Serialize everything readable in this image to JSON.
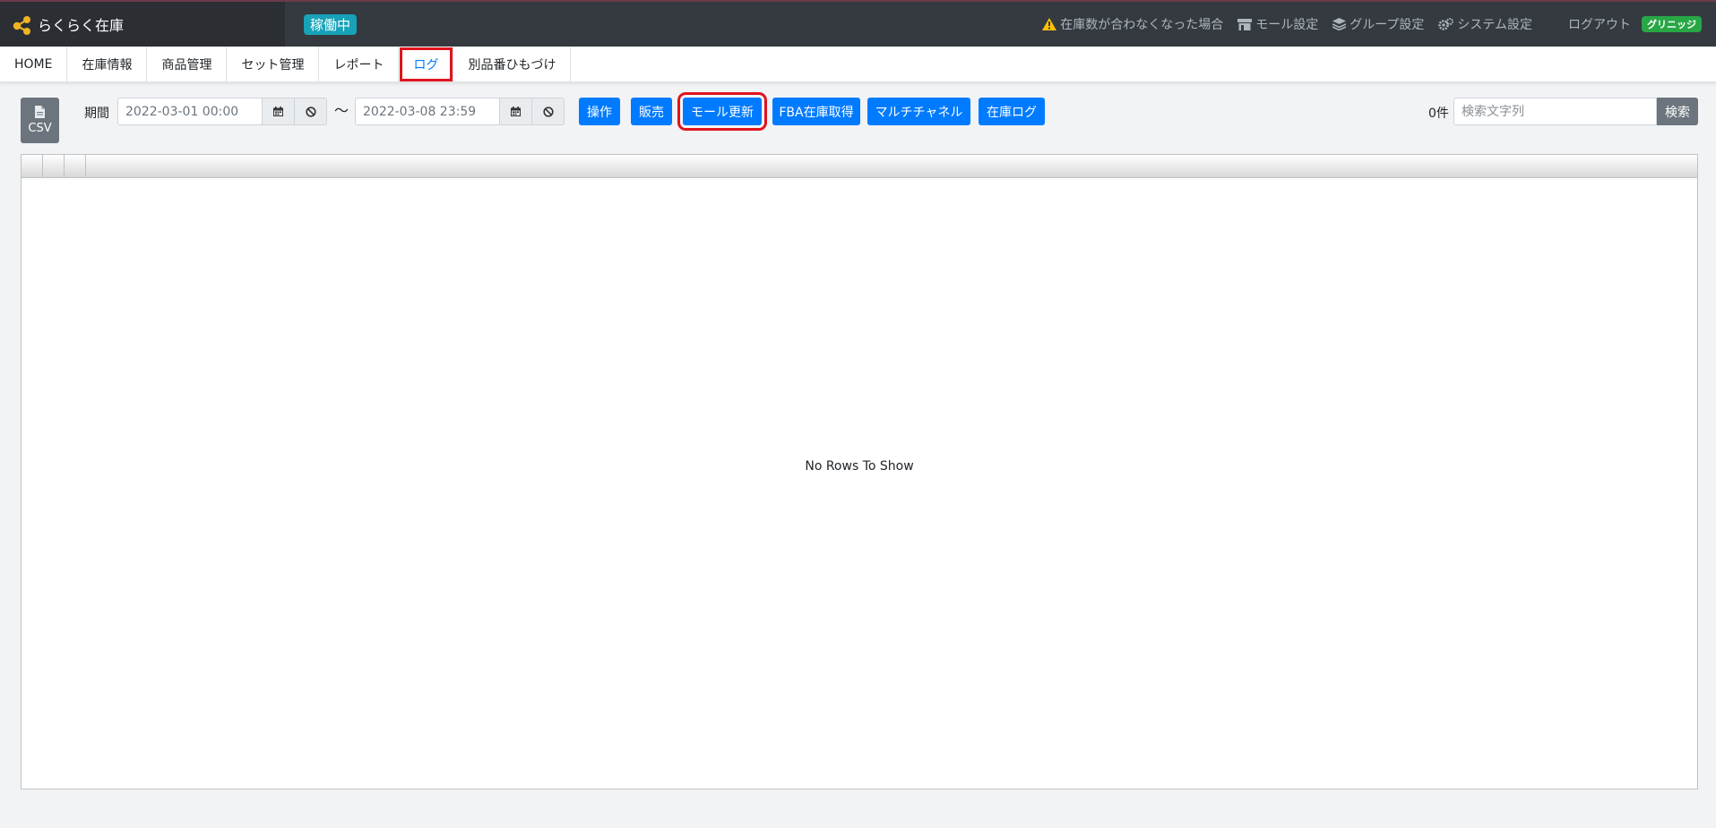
{
  "app": {
    "name": "らくらく在庫",
    "status": "稼働中"
  },
  "topnav": {
    "mismatch": "在庫数が合わなくなった場合",
    "mall_settings": "モール設定",
    "group_settings": "グループ設定",
    "system_settings": "システム設定",
    "logout": "ログアウト",
    "group_badge": "グリニッジ"
  },
  "tabs": [
    {
      "label": "HOME"
    },
    {
      "label": "在庫情報"
    },
    {
      "label": "商品管理"
    },
    {
      "label": "セット管理"
    },
    {
      "label": "レポート"
    },
    {
      "label": "ログ",
      "active": true
    },
    {
      "label": "別品番ひもづけ"
    }
  ],
  "toolbar": {
    "csv_label": "CSV",
    "period_label": "期間",
    "date_from": "2022-03-01 00:00",
    "tilde": "〜",
    "date_to": "2022-03-08 23:59",
    "buttons": {
      "operation": "操作",
      "sales": "販売",
      "mall_update": "モール更新",
      "fba_fetch": "FBA在庫取得",
      "multichannel": "マルチチャネル",
      "stock_log": "在庫ログ"
    },
    "count": "0件",
    "search_placeholder": "検索文字列",
    "search_button": "検索"
  },
  "grid": {
    "empty_message": "No Rows To Show"
  },
  "colors": {
    "topbar": "#343a40",
    "primary": "#007bff",
    "info": "#17a2b8",
    "success": "#28a745",
    "highlight": "#e0141e"
  }
}
